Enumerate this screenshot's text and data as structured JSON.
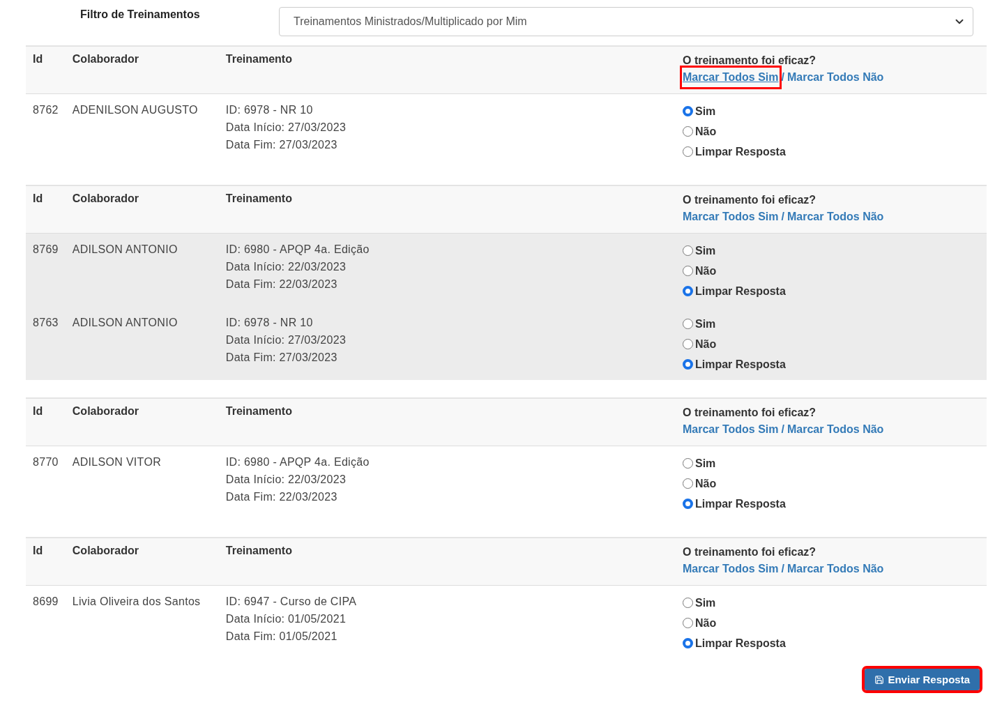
{
  "filter": {
    "label": "Filtro de Treinamentos",
    "value": "Treinamentos Ministrados/Multiplicado por Mim"
  },
  "tables": [
    {
      "columns": [
        "Id",
        "Colaborador",
        "Treinamento"
      ],
      "question": "O treinamento foi eficaz?",
      "mark_all_yes": {
        "label": "Marcar Todos Sim",
        "highlighted": true
      },
      "separator": "/",
      "mark_all_no": {
        "label": "Marcar Todos Não",
        "highlighted": false
      },
      "striped": false,
      "rows": [
        {
          "id": "8762",
          "colaborador": "ADENILSON AUGUSTO",
          "training": [
            "ID: 6978 - NR 10",
            "Data Início: 27/03/2023",
            "Data Fim: 27/03/2023"
          ],
          "options": [
            {
              "label": "Sim",
              "selected": true
            },
            {
              "label": "Não",
              "selected": false
            },
            {
              "label": "Limpar Resposta",
              "selected": false
            }
          ]
        }
      ]
    },
    {
      "columns": [
        "Id",
        "Colaborador",
        "Treinamento"
      ],
      "question": "O treinamento foi eficaz?",
      "mark_all_yes": {
        "label": "Marcar Todos Sim",
        "highlighted": false
      },
      "separator": "/",
      "mark_all_no": {
        "label": "Marcar Todos Não",
        "highlighted": false
      },
      "striped": true,
      "rows": [
        {
          "id": "8769",
          "colaborador": "ADILSON ANTONIO",
          "training": [
            "ID: 6980 - APQP 4a. Edição",
            "Data Início: 22/03/2023",
            "Data Fim: 22/03/2023"
          ],
          "options": [
            {
              "label": "Sim",
              "selected": false
            },
            {
              "label": "Não",
              "selected": false
            },
            {
              "label": "Limpar Resposta",
              "selected": true
            }
          ]
        },
        {
          "id": "8763",
          "colaborador": "ADILSON ANTONIO",
          "training": [
            "ID: 6978 - NR 10",
            "Data Início: 27/03/2023",
            "Data Fim: 27/03/2023"
          ],
          "options": [
            {
              "label": "Sim",
              "selected": false
            },
            {
              "label": "Não",
              "selected": false
            },
            {
              "label": "Limpar Resposta",
              "selected": true
            }
          ]
        }
      ]
    },
    {
      "columns": [
        "Id",
        "Colaborador",
        "Treinamento"
      ],
      "question": "O treinamento foi eficaz?",
      "mark_all_yes": {
        "label": "Marcar Todos Sim",
        "highlighted": false
      },
      "separator": "/",
      "mark_all_no": {
        "label": "Marcar Todos Não",
        "highlighted": false
      },
      "striped": false,
      "rows": [
        {
          "id": "8770",
          "colaborador": "ADILSON VITOR",
          "training": [
            "ID: 6980 - APQP 4a. Edição",
            "Data Início: 22/03/2023",
            "Data Fim: 22/03/2023"
          ],
          "options": [
            {
              "label": "Sim",
              "selected": false
            },
            {
              "label": "Não",
              "selected": false
            },
            {
              "label": "Limpar Resposta",
              "selected": true
            }
          ]
        }
      ]
    },
    {
      "columns": [
        "Id",
        "Colaborador",
        "Treinamento"
      ],
      "question": "O treinamento foi eficaz?",
      "mark_all_yes": {
        "label": "Marcar Todos Sim",
        "highlighted": false
      },
      "separator": "/",
      "mark_all_no": {
        "label": "Marcar Todos Não",
        "highlighted": false
      },
      "striped": false,
      "rows": [
        {
          "id": "8699",
          "colaborador": "Livia Oliveira dos Santos",
          "training": [
            "ID: 6947 - Curso de CIPA",
            "Data Início: 01/05/2021",
            "Data Fim: 01/05/2021"
          ],
          "options": [
            {
              "label": "Sim",
              "selected": false
            },
            {
              "label": "Não",
              "selected": false
            },
            {
              "label": "Limpar Resposta",
              "selected": true
            }
          ]
        }
      ]
    }
  ],
  "submit": {
    "label": "Enviar Resposta",
    "highlighted": true
  }
}
